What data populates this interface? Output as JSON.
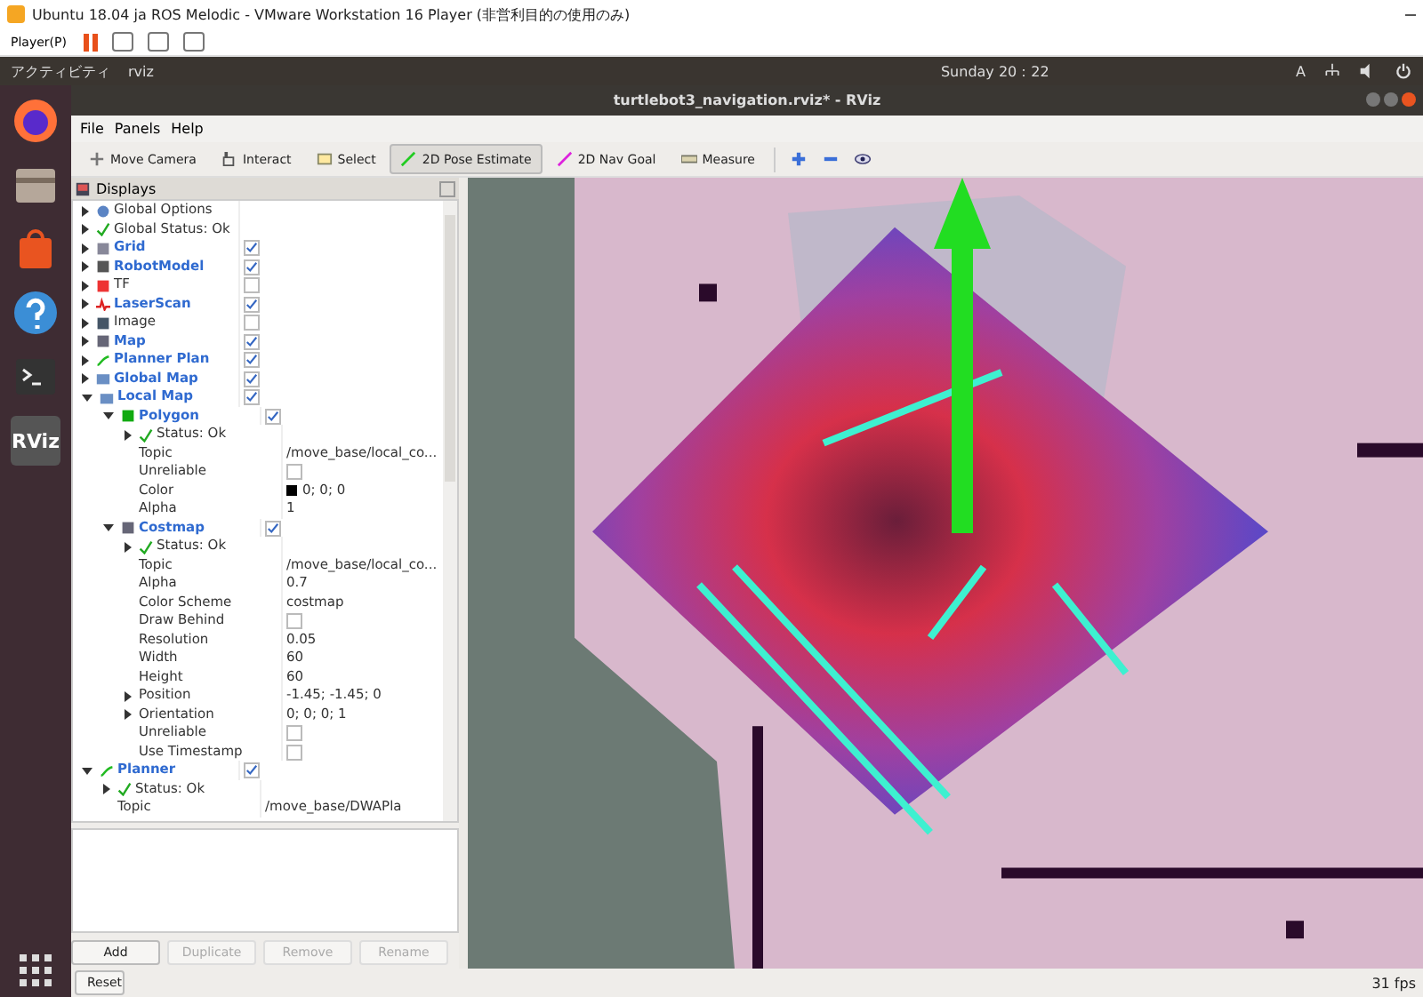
{
  "vm_window": {
    "title": "Ubuntu 18.04 ja ROS Melodic - VMware Workstation 16 Player (非営利目的の使用のみ)",
    "player_menu": "Player(P)"
  },
  "top_bar": {
    "activities": "アクティビティ",
    "app_menu": "rviz",
    "clock": "Sunday 20：22",
    "input_method": "A"
  },
  "dock": {
    "rviz_label": "RViz"
  },
  "window": {
    "title": "turtlebot3_navigation.rviz* - RViz"
  },
  "menu": [
    "File",
    "Panels",
    "Help"
  ],
  "tools": [
    {
      "label": "Move Camera",
      "kind": "camera",
      "selected": false
    },
    {
      "label": "Interact",
      "kind": "interact",
      "selected": false
    },
    {
      "label": "Select",
      "kind": "select",
      "selected": false
    },
    {
      "label": "2D Pose Estimate",
      "kind": "pose",
      "selected": true
    },
    {
      "label": "2D Nav Goal",
      "kind": "goal",
      "selected": false
    },
    {
      "label": "Measure",
      "kind": "measure",
      "selected": false
    }
  ],
  "displays": {
    "title": "Displays",
    "items": [
      {
        "label": "Global Options",
        "kind": "options",
        "expanded": false
      },
      {
        "label": "Global Status: Ok",
        "kind": "status",
        "expanded": false
      },
      {
        "label": "Grid",
        "kind": "grid",
        "expanded": false,
        "checked": true
      },
      {
        "label": "RobotModel",
        "kind": "robot",
        "expanded": false,
        "checked": true
      },
      {
        "label": "TF",
        "kind": "tf",
        "expanded": false,
        "checked": false
      },
      {
        "label": "LaserScan",
        "kind": "laser",
        "expanded": false,
        "checked": true
      },
      {
        "label": "Image",
        "kind": "image",
        "expanded": false,
        "checked": false
      },
      {
        "label": "Map",
        "kind": "map",
        "expanded": false,
        "checked": true
      },
      {
        "label": "Planner Plan",
        "kind": "path",
        "expanded": false,
        "checked": true
      },
      {
        "label": "Global Map",
        "kind": "group",
        "expanded": false,
        "checked": true
      },
      {
        "label": "Local Map",
        "kind": "group",
        "expanded": true,
        "checked": true,
        "children": [
          {
            "label": "Polygon",
            "kind": "polygon",
            "expanded": true,
            "checked": true,
            "children": [
              {
                "label": "Status: Ok",
                "kind": "status",
                "expanded": false
              },
              {
                "label": "Topic",
                "kind": "property",
                "value": "/move_base/local_co..."
              },
              {
                "label": "Unreliable",
                "kind": "property",
                "checked": false
              },
              {
                "label": "Color",
                "kind": "property",
                "value": "0; 0; 0",
                "color": "#000000"
              },
              {
                "label": "Alpha",
                "kind": "property",
                "value": "1"
              }
            ]
          },
          {
            "label": "Costmap",
            "kind": "map",
            "expanded": true,
            "checked": true,
            "children": [
              {
                "label": "Status: Ok",
                "kind": "status",
                "expanded": false
              },
              {
                "label": "Topic",
                "kind": "property",
                "value": "/move_base/local_co..."
              },
              {
                "label": "Alpha",
                "kind": "property",
                "value": "0.7"
              },
              {
                "label": "Color Scheme",
                "kind": "property",
                "value": "costmap"
              },
              {
                "label": "Draw Behind",
                "kind": "property",
                "checked": false
              },
              {
                "label": "Resolution",
                "kind": "property",
                "value": "0.05"
              },
              {
                "label": "Width",
                "kind": "property",
                "value": "60"
              },
              {
                "label": "Height",
                "kind": "property",
                "value": "60"
              },
              {
                "label": "Position",
                "kind": "property",
                "expanded": false,
                "value": "-1.45; -1.45; 0"
              },
              {
                "label": "Orientation",
                "kind": "property",
                "expanded": false,
                "value": "0; 0; 0; 1"
              },
              {
                "label": "Unreliable",
                "kind": "property",
                "checked": false
              },
              {
                "label": "Use Timestamp",
                "kind": "property",
                "checked": false
              }
            ]
          }
        ]
      },
      {
        "label": "Planner",
        "kind": "path",
        "expanded": true,
        "checked": true,
        "children": [
          {
            "label": "Status: Ok",
            "kind": "status",
            "expanded": false
          },
          {
            "label": "Topic",
            "kind": "property",
            "value": "/move_base/DWAPla"
          }
        ]
      }
    ]
  },
  "panel_buttons": [
    {
      "label": "Add",
      "disabled": false
    },
    {
      "label": "Duplicate",
      "disabled": true
    },
    {
      "label": "Remove",
      "disabled": true
    },
    {
      "label": "Rename",
      "disabled": true
    }
  ],
  "reset_button": "Reset",
  "fps": "31 fps"
}
